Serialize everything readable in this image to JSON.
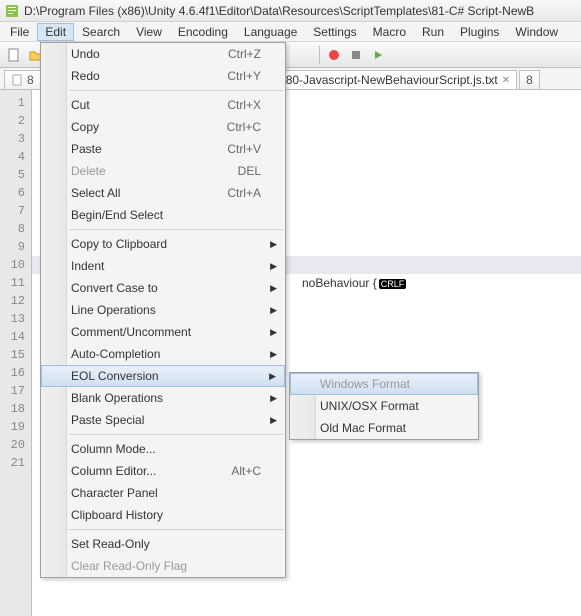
{
  "title_path": "D:\\Program Files (x86)\\Unity 4.6.4f1\\Editor\\Data\\Resources\\ScriptTemplates\\81-C# Script-NewB",
  "menu": [
    "File",
    "Edit",
    "Search",
    "View",
    "Encoding",
    "Language",
    "Settings",
    "Macro",
    "Run",
    "Plugins",
    "Window"
  ],
  "menu_active_index": 1,
  "tabs": {
    "items": [
      {
        "label": "8"
      },
      {
        "label": "80-Javascript-NewBehaviourScript.js.txt"
      },
      {
        "label": "8"
      }
    ]
  },
  "line_numbers": [
    1,
    2,
    3,
    4,
    5,
    6,
    7,
    8,
    9,
    10,
    11,
    12,
    13,
    14,
    15,
    16,
    17,
    18,
    19,
    20,
    21
  ],
  "code_visible": {
    "line": 11,
    "fragment": "noBehaviour {",
    "eol": "CRLF"
  },
  "edit_menu": {
    "groups": [
      [
        {
          "label": "Undo",
          "shortcut": "Ctrl+Z"
        },
        {
          "label": "Redo",
          "shortcut": "Ctrl+Y"
        }
      ],
      [
        {
          "label": "Cut",
          "shortcut": "Ctrl+X"
        },
        {
          "label": "Copy",
          "shortcut": "Ctrl+C"
        },
        {
          "label": "Paste",
          "shortcut": "Ctrl+V"
        },
        {
          "label": "Delete",
          "shortcut": "DEL",
          "disabled": true
        },
        {
          "label": "Select All",
          "shortcut": "Ctrl+A"
        },
        {
          "label": "Begin/End Select"
        }
      ],
      [
        {
          "label": "Copy to Clipboard",
          "submenu": true
        },
        {
          "label": "Indent",
          "submenu": true
        },
        {
          "label": "Convert Case to",
          "submenu": true
        },
        {
          "label": "Line Operations",
          "submenu": true
        },
        {
          "label": "Comment/Uncomment",
          "submenu": true
        },
        {
          "label": "Auto-Completion",
          "submenu": true
        },
        {
          "label": "EOL Conversion",
          "submenu": true,
          "highlight": true
        },
        {
          "label": "Blank Operations",
          "submenu": true
        },
        {
          "label": "Paste Special",
          "submenu": true
        }
      ],
      [
        {
          "label": "Column Mode..."
        },
        {
          "label": "Column Editor...",
          "shortcut": "Alt+C"
        },
        {
          "label": "Character Panel"
        },
        {
          "label": "Clipboard History"
        }
      ],
      [
        {
          "label": "Set Read-Only"
        },
        {
          "label": "Clear Read-Only Flag",
          "disabled": true
        }
      ]
    ]
  },
  "eol_submenu": [
    {
      "label": "Windows Format",
      "highlight": true,
      "disabled": true
    },
    {
      "label": "UNIX/OSX Format"
    },
    {
      "label": "Old Mac Format"
    }
  ]
}
